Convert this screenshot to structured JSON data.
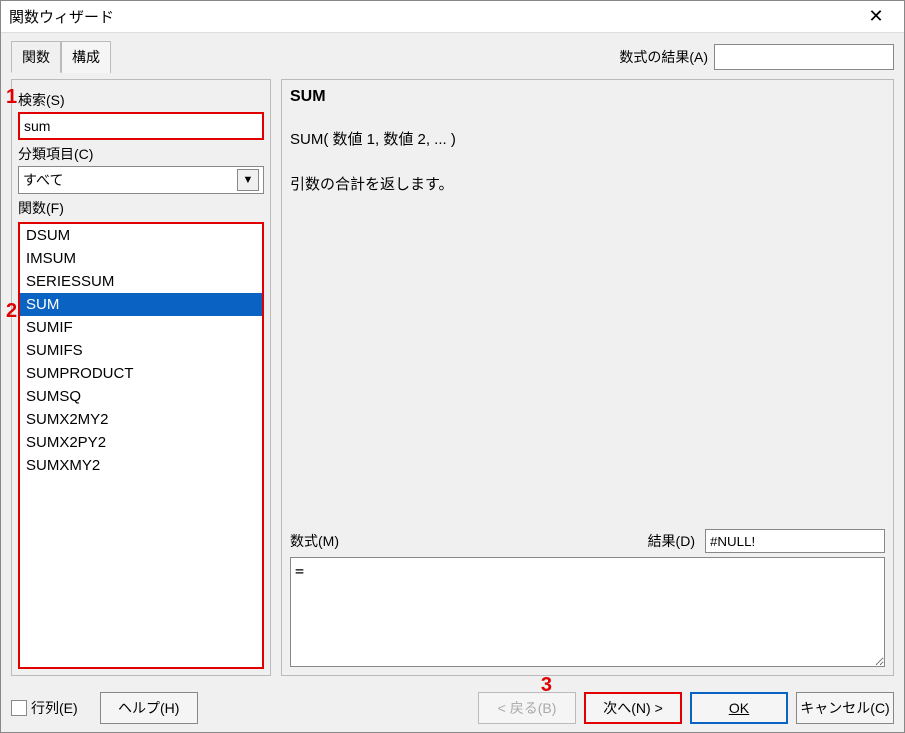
{
  "title": "関数ウィザード",
  "tabs": {
    "functions": "関数",
    "structure": "構成"
  },
  "result_label": "数式の結果(A)",
  "result_value": "",
  "search": {
    "label": "検索(S)",
    "value": "sum"
  },
  "category": {
    "label": "分類項目(C)",
    "value": "すべて"
  },
  "function_list_label": "関数(F)",
  "functions": [
    "DSUM",
    "IMSUM",
    "SERIESSUM",
    "SUM",
    "SUMIF",
    "SUMIFS",
    "SUMPRODUCT",
    "SUMSQ",
    "SUMX2MY2",
    "SUMX2PY2",
    "SUMXMY2"
  ],
  "selected_function_index": 3,
  "detail": {
    "name": "SUM",
    "syntax": "SUM( 数値 1, 数値 2, ... )",
    "description": "引数の合計を返します。"
  },
  "formula": {
    "label": "数式(M)",
    "value": "="
  },
  "small_result": {
    "label": "結果(D)",
    "value": "#NULL!"
  },
  "matrix_label": "行列(E)",
  "buttons": {
    "help": "ヘルプ(H)",
    "back": "< 戻る(B)",
    "next": "次へ(N) >",
    "ok": "OK",
    "cancel": "キャンセル(C)"
  },
  "callouts": {
    "c1": "1",
    "c2": "2",
    "c3": "3"
  }
}
